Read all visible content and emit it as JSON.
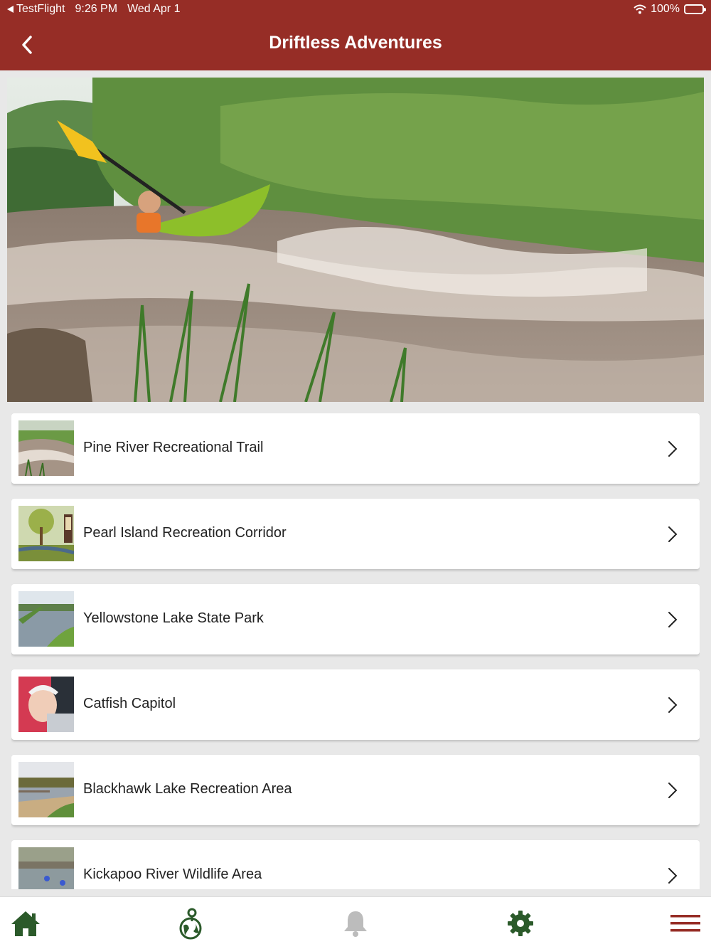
{
  "status_bar": {
    "back_app": "TestFlight",
    "time": "9:26 PM",
    "date": "Wed Apr 1",
    "battery": "100%"
  },
  "header": {
    "title": "Driftless Adventures",
    "back_icon": "chevron-left-icon"
  },
  "hero": {
    "description_icon": "hero-image"
  },
  "list": {
    "items": [
      {
        "label": "Pine River Recreational Trail"
      },
      {
        "label": "Pearl Island Recreation Corridor"
      },
      {
        "label": "Yellowstone Lake State Park"
      },
      {
        "label": "Catfish Capitol"
      },
      {
        "label": "Blackhawk Lake Recreation Area"
      },
      {
        "label": "Kickapoo River Wildlife Area"
      }
    ]
  },
  "tabbar": {
    "tabs": [
      {
        "icon": "home-icon"
      },
      {
        "icon": "globe-pin-icon"
      },
      {
        "icon": "bell-icon"
      },
      {
        "icon": "gear-icon"
      },
      {
        "icon": "menu-icon"
      }
    ]
  },
  "colors": {
    "header": "#962d26",
    "tab_green": "#2b5a2a",
    "tab_gray": "#bcbcbc",
    "menu_red": "#962d26"
  }
}
